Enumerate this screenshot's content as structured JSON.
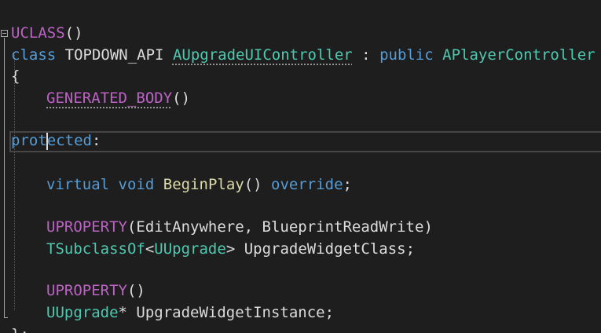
{
  "editor": {
    "lines": [
      {
        "tokens": [
          "UCLASS",
          "()"
        ]
      },
      {
        "tokens": [
          "class",
          " ",
          "TOPDOWN_API",
          " ",
          "AUpgradeUIController",
          " : ",
          "public",
          " ",
          "APlayerController"
        ]
      },
      {
        "tokens": [
          "{"
        ]
      },
      {
        "tokens": [
          "GENERATED_BODY",
          "()"
        ]
      },
      {
        "tokens": []
      },
      {
        "tokens": [
          "protected",
          ":"
        ]
      },
      {
        "tokens": []
      },
      {
        "tokens": [
          "virtual",
          " ",
          "void",
          " ",
          "BeginPlay",
          "() ",
          "override",
          ";"
        ]
      },
      {
        "tokens": []
      },
      {
        "tokens": [
          "UPROPERTY",
          "(EditAnywhere, BlueprintReadWrite)"
        ]
      },
      {
        "tokens": [
          "TSubclassOf",
          "<",
          "UUpgrade",
          "> UpgradeWidgetClass;"
        ]
      },
      {
        "tokens": []
      },
      {
        "tokens": [
          "UPROPERTY",
          "()"
        ]
      },
      {
        "tokens": [
          "UUpgrade",
          "* UpgradeWidgetInstance;"
        ]
      },
      {
        "tokens": [
          "};"
        ]
      }
    ]
  },
  "colors": {
    "background": "#1e1e1e",
    "keyword": "#569cd6",
    "type": "#4ec9b0",
    "function": "#dcdcaa",
    "macro": "#bd63c5",
    "text": "#dcdcdc"
  }
}
